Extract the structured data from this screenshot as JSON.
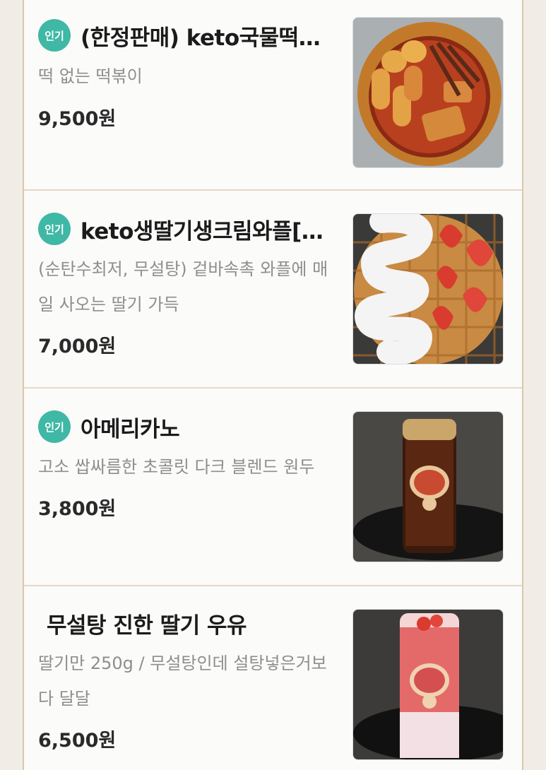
{
  "menu": {
    "items": [
      {
        "badge": "인기",
        "title": "(한정판매) keto국물떡…",
        "description": "떡 없는 떡볶이",
        "price": "9,500원",
        "image_icon": "tteokbokki-photo"
      },
      {
        "badge": "인기",
        "title": "keto생딸기생크림와플[…",
        "description": "(순탄수최저, 무설탕) 겉바속촉 와플에 매일 사오는 딸기 가득",
        "price": "7,000원",
        "image_icon": "strawberry-waffle-photo"
      },
      {
        "badge": "인기",
        "title": "아메리카노",
        "description": "고소 쌉싸름한 초콜릿 다크 블렌드 원두",
        "price": "3,800원",
        "image_icon": "americano-bottle-photo"
      },
      {
        "badge": "",
        "title": "무설탕 진한 딸기 우유",
        "description": "딸기만 250g / 무설탕인데 설탕넣은거보다 달달",
        "price": "6,500원",
        "image_icon": "strawberry-milk-photo"
      }
    ]
  },
  "colors": {
    "badge": "#3fb8a6",
    "background": "#fbfbfa",
    "frame": "#d9c7ad"
  }
}
